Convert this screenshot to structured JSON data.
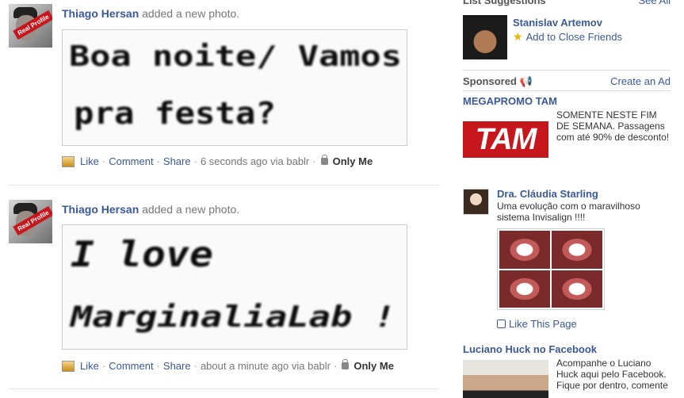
{
  "feed": {
    "stories": [
      {
        "author": "Thiago Hersan",
        "action": "added a new photo.",
        "avatar_badge": [
          "Real",
          "Profile"
        ],
        "photo_lines": [
          "Boa noite/ Vamos",
          "pra festa?"
        ],
        "like": "Like",
        "comment": "Comment",
        "share": "Share",
        "time": "6 seconds ago via bablr",
        "audience": "Only Me"
      },
      {
        "author": "Thiago Hersan",
        "action": "added a new photo.",
        "avatar_badge": [
          "Real",
          "Profile"
        ],
        "photo_lines": [
          "I love",
          "MarginaliaLab !"
        ],
        "like": "Like",
        "comment": "Comment",
        "share": "Share",
        "time": "about a minute ago via bablr",
        "audience": "Only Me"
      }
    ]
  },
  "rail": {
    "suggestions": {
      "title": "List Suggestions",
      "see_all": "See All",
      "person": "Stanislav Artemov",
      "action": "Add to Close Friends"
    },
    "sponsored": {
      "title": "Sponsored",
      "create": "Create an Ad",
      "ads": [
        {
          "title": "MEGAPROMO TAM",
          "logo_text": "TAM",
          "text": "SOMENTE NESTE FIM DE SEMANA. Passagens com até 90% de desconto!"
        },
        {
          "title": "Dra. Cláudia Starling",
          "text": "Uma evolução com o maravilhoso sistema Invisalign !!!!",
          "like_page": "Like This Page"
        },
        {
          "title": "Luciano Huck no Facebook",
          "text": "Acompanhe o Luciano Huck aqui pelo Facebook. Fique por dentro, comente"
        }
      ]
    }
  },
  "colors": {
    "link": "#3b5998",
    "muted": "#777777",
    "tam_red": "#c8161d"
  }
}
